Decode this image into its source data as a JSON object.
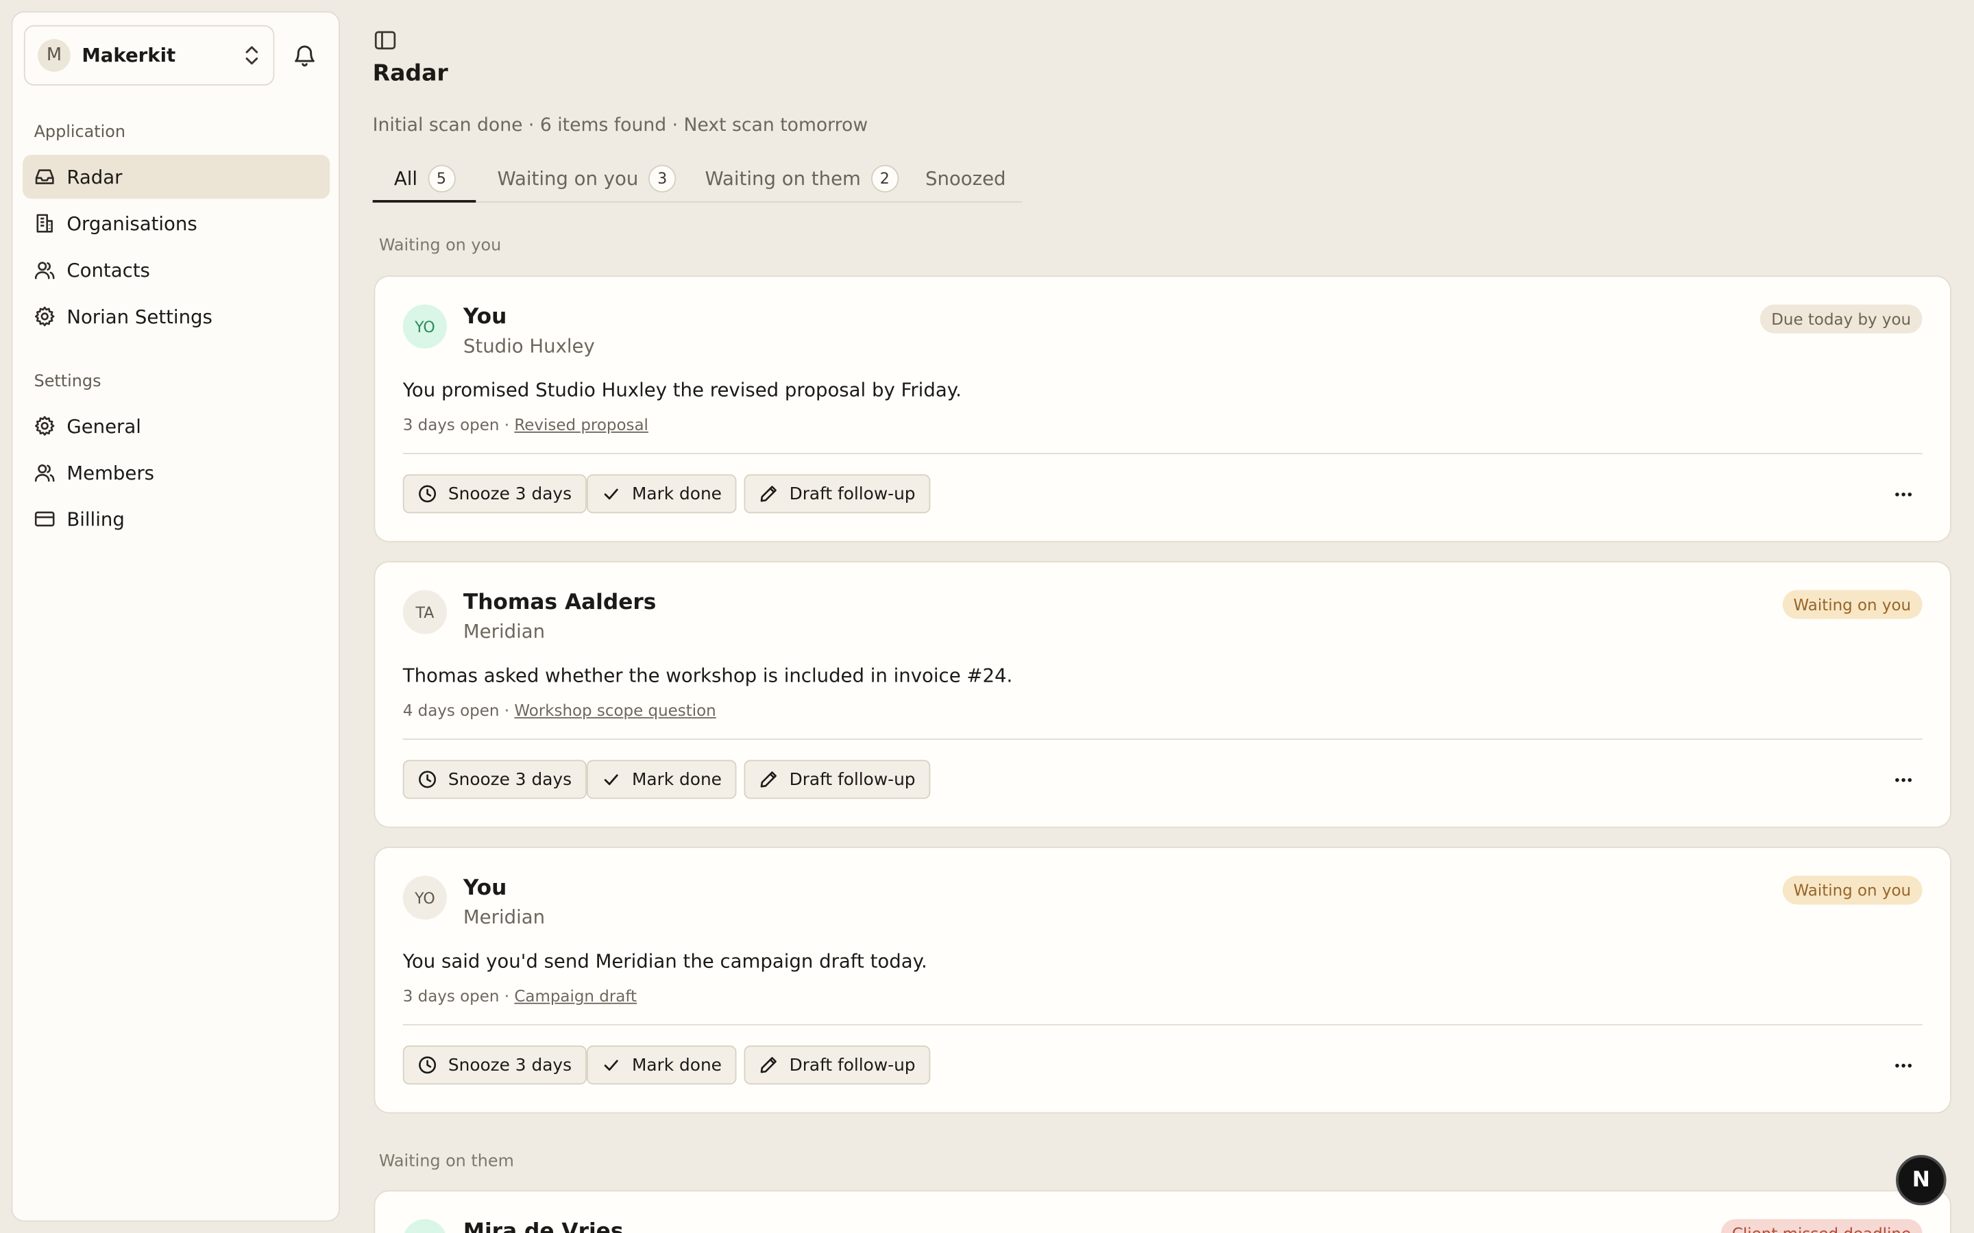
{
  "sidebar": {
    "team": {
      "initial": "M",
      "name": "Makerkit"
    },
    "sections": [
      {
        "title": "Application",
        "items": [
          {
            "label": "Radar",
            "icon": "inbox-icon",
            "active": true
          },
          {
            "label": "Organisations",
            "icon": "building-icon"
          },
          {
            "label": "Contacts",
            "icon": "users-icon"
          },
          {
            "label": "Norian Settings",
            "icon": "gear-icon"
          }
        ]
      },
      {
        "title": "Settings",
        "items": [
          {
            "label": "General",
            "icon": "gear-icon"
          },
          {
            "label": "Members",
            "icon": "users-icon"
          },
          {
            "label": "Billing",
            "icon": "credit-card-icon"
          }
        ]
      }
    ]
  },
  "page": {
    "title": "Radar",
    "subtitle": "Initial scan done · 6 items found · Next scan tomorrow"
  },
  "tabs": [
    {
      "label": "All",
      "count": "5",
      "active": true
    },
    {
      "label": "Waiting on you",
      "count": "3"
    },
    {
      "label": "Waiting on them",
      "count": "2"
    },
    {
      "label": "Snoozed"
    }
  ],
  "groups": [
    {
      "label": "Waiting on you"
    },
    {
      "label": "Waiting on them"
    }
  ],
  "actions": {
    "snooze": "Snooze 3 days",
    "done": "Mark done",
    "draft": "Draft follow-up"
  },
  "cards": [
    {
      "initials": "YO",
      "name": "You",
      "org": "Studio Huxley",
      "status": "Due today by you",
      "summary": "You promised Studio Huxley the revised proposal by Friday.",
      "open": "3 days open",
      "thread": "Revised proposal"
    },
    {
      "initials": "TA",
      "name": "Thomas Aalders",
      "org": "Meridian",
      "status": "Waiting on you",
      "summary": "Thomas asked whether the workshop is included in invoice #24.",
      "open": "4 days open",
      "thread": "Workshop scope question"
    },
    {
      "initials": "YO",
      "name": "You",
      "org": "Meridian",
      "status": "Waiting on you",
      "summary": "You said you'd send Meridian the campaign draft today.",
      "open": "3 days open",
      "thread": "Campaign draft"
    }
  ],
  "partial_card": {
    "name": "Mira de Vries",
    "status": "Client missed deadline"
  },
  "fab": {
    "label": "N"
  },
  "colors": {
    "background": "#efebe2",
    "sidebar": "#fdfcf8",
    "active_nav": "#ece5d6",
    "status_due": "#efe8da",
    "status_waiting": "#f7e7c6",
    "status_missed": "#f6d9d2"
  }
}
